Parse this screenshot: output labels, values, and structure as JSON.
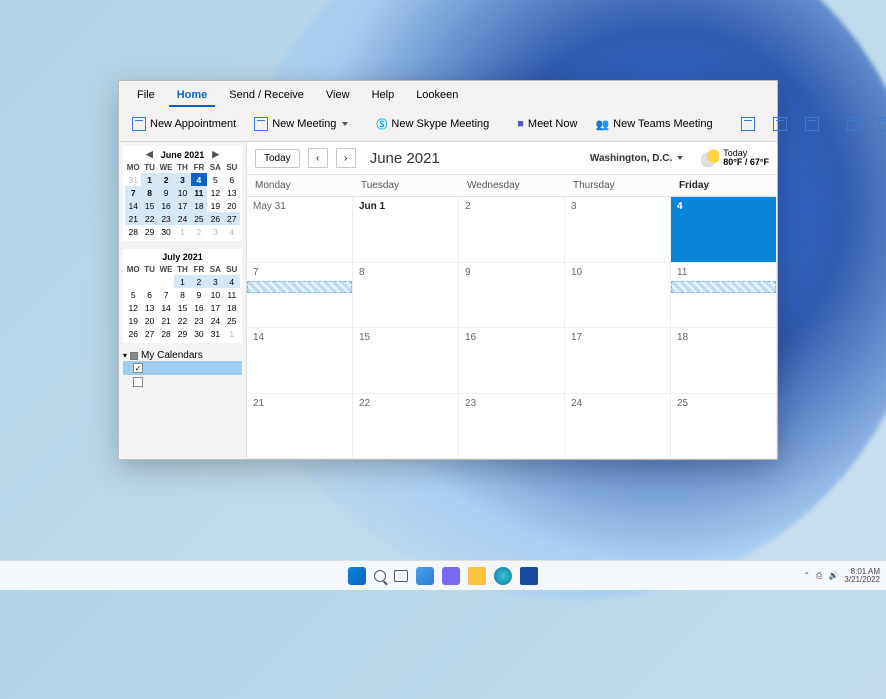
{
  "menu": {
    "file": "File",
    "home": "Home",
    "send": "Send / Receive",
    "view": "View",
    "help": "Help",
    "lookeen": "Lookeen"
  },
  "toolbar": {
    "new_appt": "New Appointment",
    "new_meeting": "New Meeting",
    "new_skype": "New Skype Meeting",
    "meet_now": "Meet Now",
    "new_teams": "New Teams Meeting"
  },
  "mini1": {
    "title": "June 2021",
    "dow": [
      "MO",
      "TU",
      "WE",
      "TH",
      "FR",
      "SA",
      "SU"
    ],
    "days": [
      {
        "n": "31",
        "dim": true
      },
      {
        "n": "1",
        "hl": true,
        "bold": true
      },
      {
        "n": "2",
        "hl": true,
        "bold": true
      },
      {
        "n": "3",
        "hl": true,
        "bold": true
      },
      {
        "n": "4",
        "sel": true,
        "bold": true
      },
      {
        "n": "5"
      },
      {
        "n": "6"
      },
      {
        "n": "7",
        "hl": true,
        "bold": true
      },
      {
        "n": "8",
        "hl": true,
        "bold": true
      },
      {
        "n": "9",
        "hl": true
      },
      {
        "n": "10",
        "hl": true
      },
      {
        "n": "11",
        "hl": true,
        "bold": true
      },
      {
        "n": "12"
      },
      {
        "n": "13"
      },
      {
        "n": "14",
        "hl": true
      },
      {
        "n": "15",
        "hl": true
      },
      {
        "n": "16",
        "hl": true
      },
      {
        "n": "17",
        "hl": true
      },
      {
        "n": "18",
        "hl": true
      },
      {
        "n": "19"
      },
      {
        "n": "20"
      },
      {
        "n": "21",
        "hl": true
      },
      {
        "n": "22",
        "hl": true
      },
      {
        "n": "23",
        "hl": true
      },
      {
        "n": "24",
        "hl": true
      },
      {
        "n": "25",
        "hl": true
      },
      {
        "n": "26",
        "hl": true
      },
      {
        "n": "27",
        "hl": true
      },
      {
        "n": "28"
      },
      {
        "n": "29"
      },
      {
        "n": "30"
      },
      {
        "n": "1",
        "dim": true
      },
      {
        "n": "2",
        "dim": true
      },
      {
        "n": "3",
        "dim": true
      },
      {
        "n": "4",
        "dim": true
      }
    ]
  },
  "mini2": {
    "title": "July 2021",
    "dow": [
      "MO",
      "TU",
      "WE",
      "TH",
      "FR",
      "SA",
      "SU"
    ],
    "days": [
      {
        "n": ""
      },
      {
        "n": ""
      },
      {
        "n": ""
      },
      {
        "n": "1",
        "hl": true
      },
      {
        "n": "2",
        "hl": true
      },
      {
        "n": "3",
        "hl": true
      },
      {
        "n": "4",
        "hl": true
      },
      {
        "n": "5"
      },
      {
        "n": "6"
      },
      {
        "n": "7"
      },
      {
        "n": "8"
      },
      {
        "n": "9"
      },
      {
        "n": "10"
      },
      {
        "n": "11"
      },
      {
        "n": "12"
      },
      {
        "n": "13"
      },
      {
        "n": "14"
      },
      {
        "n": "15"
      },
      {
        "n": "16"
      },
      {
        "n": "17"
      },
      {
        "n": "18"
      },
      {
        "n": "19"
      },
      {
        "n": "20"
      },
      {
        "n": "21"
      },
      {
        "n": "22"
      },
      {
        "n": "23"
      },
      {
        "n": "24"
      },
      {
        "n": "25"
      },
      {
        "n": "26"
      },
      {
        "n": "27"
      },
      {
        "n": "28"
      },
      {
        "n": "29"
      },
      {
        "n": "30"
      },
      {
        "n": "31"
      },
      {
        "n": "1",
        "dim": true
      }
    ]
  },
  "cals": {
    "header": "My Calendars"
  },
  "main": {
    "today": "Today",
    "period": "June 2021",
    "location": "Washington, D.C.",
    "weather": {
      "label": "Today",
      "temp": "80°F / 67°F"
    },
    "dow": [
      {
        "l": "Monday"
      },
      {
        "l": "Tuesday"
      },
      {
        "l": "Wednesday"
      },
      {
        "l": "Thursday"
      },
      {
        "l": "Friday",
        "bold": true
      }
    ],
    "weeks": [
      [
        {
          "l": "May 31"
        },
        {
          "l": "Jun 1",
          "bold": true
        },
        {
          "l": "2"
        },
        {
          "l": "3"
        },
        {
          "l": "4",
          "today": true
        }
      ],
      [
        {
          "l": "7",
          "band": true
        },
        {
          "l": "8"
        },
        {
          "l": "9"
        },
        {
          "l": "10"
        },
        {
          "l": "11",
          "band": true
        }
      ],
      [
        {
          "l": "14"
        },
        {
          "l": "15"
        },
        {
          "l": "16"
        },
        {
          "l": "17"
        },
        {
          "l": "18"
        }
      ],
      [
        {
          "l": "21"
        },
        {
          "l": "22"
        },
        {
          "l": "23"
        },
        {
          "l": "24"
        },
        {
          "l": "25"
        }
      ]
    ]
  },
  "tray": {
    "time": "8:01 AM",
    "date": "3/21/2022"
  }
}
